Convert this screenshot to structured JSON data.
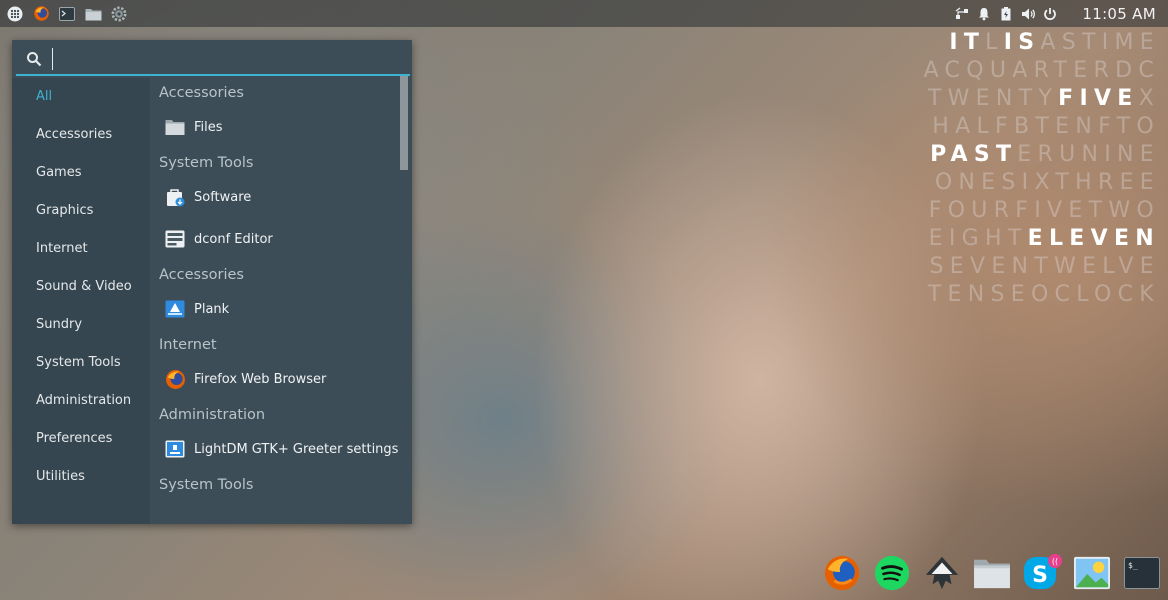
{
  "topbar": {
    "left_icons": [
      "app-grid-icon",
      "firefox-icon",
      "terminal-icon",
      "files-icon",
      "settings-icon"
    ],
    "tray_icons": [
      "network-icon",
      "notification-bell-icon",
      "battery-icon",
      "volume-icon",
      "power-icon"
    ],
    "clock": "11:05 AM"
  },
  "menu": {
    "search": {
      "value": "",
      "placeholder": ""
    },
    "categories": [
      "All",
      "Accessories",
      "Games",
      "Graphics",
      "Internet",
      "Sound & Video",
      "Sundry",
      "System Tools",
      "Administration",
      "Preferences",
      "Utilities"
    ],
    "active_category": "All",
    "sections": [
      {
        "title": "Accessories",
        "apps": [
          {
            "name": "Files",
            "icon": "folder-icon"
          }
        ]
      },
      {
        "title": "System Tools",
        "apps": [
          {
            "name": "Software",
            "icon": "software-center-icon"
          },
          {
            "name": "dconf Editor",
            "icon": "dconf-editor-icon"
          }
        ]
      },
      {
        "title": "Accessories",
        "apps": [
          {
            "name": "Plank",
            "icon": "plank-icon"
          }
        ]
      },
      {
        "title": "Internet",
        "apps": [
          {
            "name": "Firefox Web Browser",
            "icon": "firefox-icon"
          }
        ]
      },
      {
        "title": "Administration",
        "apps": [
          {
            "name": "LightDM GTK+ Greeter settings",
            "icon": "lightdm-settings-icon"
          }
        ]
      },
      {
        "title": "System Tools",
        "apps": []
      }
    ]
  },
  "word_clock": {
    "rows": [
      "ITLISASTIME",
      "ACQUARTERDC",
      "TWENTYFIVEX",
      "HALFBTENFTO",
      "PASTERUNINE",
      "ONESIXTHREE",
      "FOURFIVETWO",
      "EIGHTELEVEN",
      "SEVENTWELVE",
      "TENSEOCLOCK"
    ],
    "lit_words": [
      "IT",
      "IS",
      "FIVE",
      "PAST",
      "ELEVEN"
    ]
  },
  "dock": {
    "icons": [
      "firefox-icon",
      "spotify-icon",
      "inkscape-icon",
      "files-icon",
      "skype-icon",
      "image-viewer-icon",
      "terminal-icon"
    ]
  },
  "colors": {
    "menu_bg": "#3c4d57",
    "sidebar_bg": "#364650",
    "accent": "#3eb3d1"
  }
}
